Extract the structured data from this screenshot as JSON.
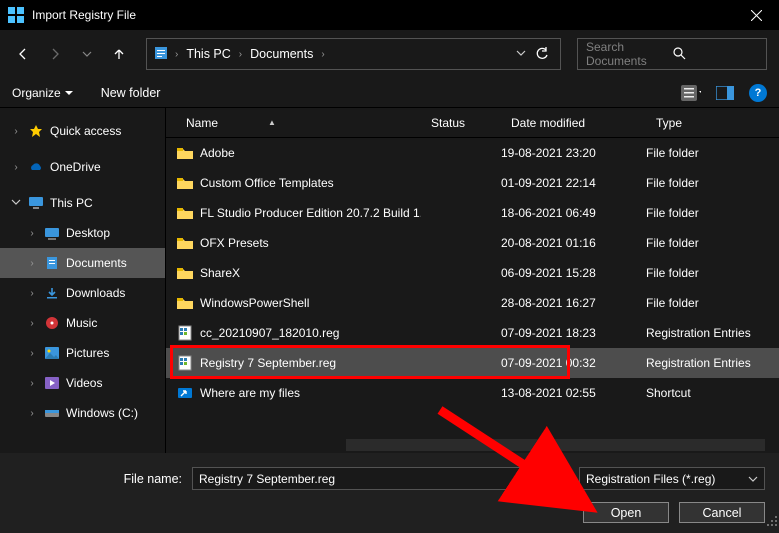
{
  "window": {
    "title": "Import Registry File"
  },
  "address": {
    "pcicon_label": "This PC",
    "segments": [
      "This PC",
      "Documents"
    ]
  },
  "search": {
    "placeholder": "Search Documents"
  },
  "toolbar": {
    "organize": "Organize",
    "newfolder": "New folder"
  },
  "tree": {
    "quick": "Quick access",
    "onedrive": "OneDrive",
    "thispc": "This PC",
    "desktop": "Desktop",
    "documents": "Documents",
    "downloads": "Downloads",
    "music": "Music",
    "pictures": "Pictures",
    "videos": "Videos",
    "windowsc": "Windows (C:)"
  },
  "columns": {
    "name": "Name",
    "status": "Status",
    "date": "Date modified",
    "type": "Type"
  },
  "files": [
    {
      "name": "Adobe",
      "date": "19-08-2021 23:20",
      "type": "File folder",
      "icon": "folder"
    },
    {
      "name": "Custom Office Templates",
      "date": "01-09-2021 22:14",
      "type": "File folder",
      "icon": "folder"
    },
    {
      "name": "FL Studio Producer Edition 20.7.2 Build 1...",
      "date": "18-06-2021 06:49",
      "type": "File folder",
      "icon": "folder"
    },
    {
      "name": "OFX Presets",
      "date": "20-08-2021 01:16",
      "type": "File folder",
      "icon": "folder"
    },
    {
      "name": "ShareX",
      "date": "06-09-2021 15:28",
      "type": "File folder",
      "icon": "folder"
    },
    {
      "name": "WindowsPowerShell",
      "date": "28-08-2021 16:27",
      "type": "File folder",
      "icon": "folder"
    },
    {
      "name": "cc_20210907_182010.reg",
      "date": "07-09-2021 18:23",
      "type": "Registration Entries",
      "icon": "reg"
    },
    {
      "name": "Registry 7 September.reg",
      "date": "07-09-2021 00:32",
      "type": "Registration Entries",
      "icon": "reg",
      "selected": true
    },
    {
      "name": "Where are my files",
      "date": "13-08-2021 02:55",
      "type": "Shortcut",
      "icon": "shortcut"
    }
  ],
  "footer": {
    "filename_label": "File name:",
    "filename_value": "Registry 7 September.reg",
    "filter": "Registration Files (*.reg)",
    "open": "Open",
    "cancel": "Cancel"
  }
}
